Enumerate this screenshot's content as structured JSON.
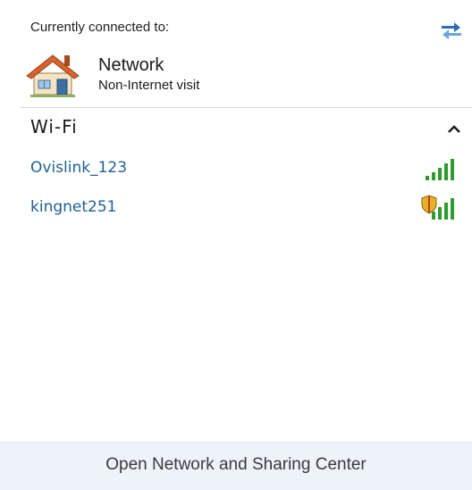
{
  "header": {
    "label": "Currently connected to:",
    "refresh_icon": "refresh-arrows-icon"
  },
  "connected": {
    "name": "Network",
    "status": "Non-Internet visit",
    "icon": "house-network-icon"
  },
  "wifi": {
    "title": "Wi-Fi",
    "collapse_icon": "chevron-up-icon",
    "networks": [
      {
        "name": "Ovislink_123",
        "icon": "signal-bars-icon",
        "secured": false
      },
      {
        "name": "kingnet251",
        "icon": "signal-bars-shield-icon",
        "secured": true
      }
    ]
  },
  "footer": {
    "link_label": "Open Network and Sharing Center"
  },
  "colors": {
    "link_blue": "#1f5f96",
    "signal_green": "#2e9b2e",
    "footer_bg": "#eef3f9"
  }
}
